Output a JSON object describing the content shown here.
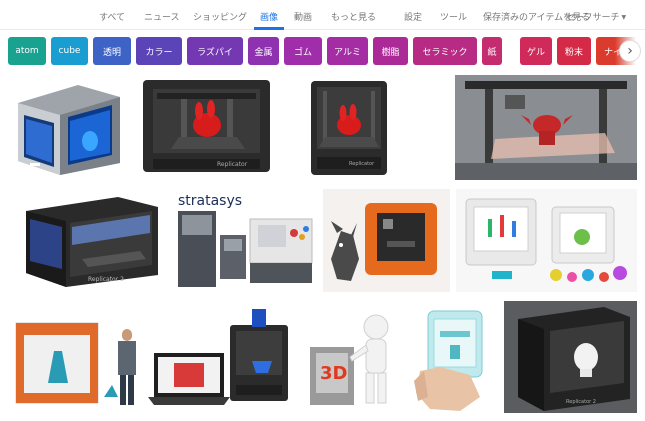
{
  "nav": {
    "tabs": [
      "すべて",
      "ニュース",
      "ショッピング",
      "画像",
      "動画",
      "もっと見る"
    ],
    "active_tab": "画像",
    "settings": "設定",
    "tools": "ツール",
    "saved": "保存済みのアイテムを見る",
    "safesearch": "セーフサーチ"
  },
  "chips": [
    {
      "label": "atom",
      "color": "#1aa291"
    },
    {
      "label": "cube",
      "color": "#1a9dd0"
    },
    {
      "label": "透明",
      "color": "#3d63c6"
    },
    {
      "label": "カラー",
      "color": "#5a44b8"
    },
    {
      "label": "ラズパイ",
      "color": "#7438b2"
    },
    {
      "label": "金属",
      "color": "#8e32b0"
    },
    {
      "label": "ゴム",
      "color": "#a02eaa"
    },
    {
      "label": "アルミ",
      "color": "#a52da4"
    },
    {
      "label": "樹脂",
      "color": "#ac2a97"
    },
    {
      "label": "セラミック",
      "color": "#b82b84"
    },
    {
      "label": "紙",
      "color": "#c52c6f"
    },
    {
      "label": "ゲル",
      "color": "#cf2a5a"
    },
    {
      "label": "粉末",
      "color": "#d42a47"
    },
    {
      "label": "ナイロン",
      "color": "#db3b2c"
    }
  ],
  "images": {
    "row1": [
      {
        "name": "atom-blue-printer"
      },
      {
        "name": "makerbot-replicator-red-bunny"
      },
      {
        "name": "makerbot-replicator-red-bunny-2"
      },
      {
        "name": "printer-red-yoda"
      }
    ],
    "row2": [
      {
        "name": "replicator-2-black"
      },
      {
        "name": "stratasys-printers",
        "text": "stratasys"
      },
      {
        "name": "orange-cube-printer"
      },
      {
        "name": "white-printer-colorful-prints"
      }
    ],
    "row3": [
      {
        "name": "large-white-printer-with-man"
      },
      {
        "name": "printer-with-laptop"
      },
      {
        "name": "3d-figure-character",
        "text": "3D"
      },
      {
        "name": "hand-held-mini-printer"
      },
      {
        "name": "replicator-2-white-bust"
      }
    ]
  }
}
